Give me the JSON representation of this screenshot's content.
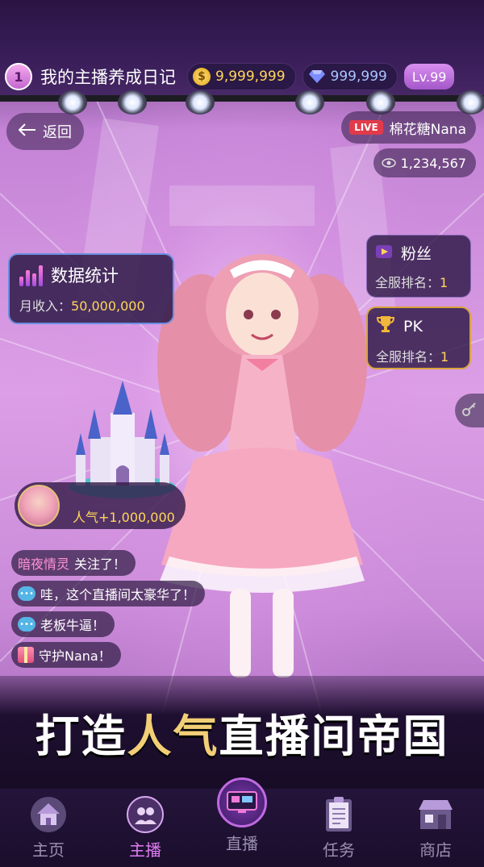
{
  "header": {
    "level_number": "1",
    "title": "我的主播养成日记",
    "coins": "9,999,999",
    "diamonds": "999,999",
    "level": "Lv.99"
  },
  "nav": {
    "back_label": "返回"
  },
  "streamer": {
    "live_tag": "LIVE",
    "name": "棉花糖Nana",
    "viewers": "1,234,567"
  },
  "stats": {
    "title": "数据统计",
    "income_label": "月收入：",
    "income_value": "50,000,000"
  },
  "ranks": [
    {
      "title": "粉丝",
      "label": "全服排名：",
      "value": "1"
    },
    {
      "title": "PK",
      "label": "全服排名：",
      "value": "1"
    }
  ],
  "gift": {
    "text": "人气+1,000,000"
  },
  "chat": [
    {
      "user": "暗夜情灵",
      "text": " 关注了！"
    },
    {
      "text": "哇，这个直播间太豪华了！"
    },
    {
      "text": "老板牛逼！"
    },
    {
      "text": "守护Nana！"
    }
  ],
  "banner": {
    "part1": "打造",
    "part2": "人气",
    "part3": "直播间帝国"
  },
  "tabs": [
    {
      "label": "主页",
      "icon": "home-icon"
    },
    {
      "label": "主播",
      "icon": "streamer-icon",
      "active": true
    },
    {
      "label": "直播",
      "icon": "live-tv-icon"
    },
    {
      "label": "任务",
      "icon": "task-icon"
    },
    {
      "label": "商店",
      "icon": "shop-icon"
    }
  ],
  "colors": {
    "accent": "#e07bf2",
    "gold": "#ffd75a",
    "live_red": "#e33a4a"
  }
}
